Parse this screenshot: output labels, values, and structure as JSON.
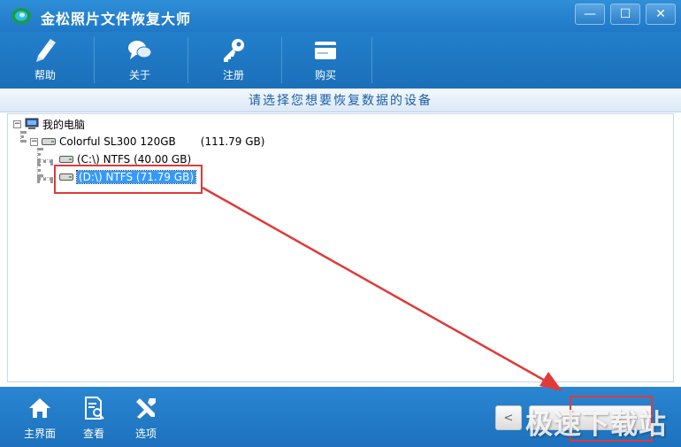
{
  "window": {
    "title": "金松照片文件恢复大师",
    "controls": {
      "minimize": "—",
      "maximize": "☐",
      "close": "✕"
    }
  },
  "toolbar": {
    "items": [
      {
        "label": "帮助",
        "icon": "help-pen-icon"
      },
      {
        "label": "关于",
        "icon": "chat-bubbles-icon"
      },
      {
        "label": "注册",
        "icon": "key-icon"
      },
      {
        "label": "购买",
        "icon": "card-icon"
      }
    ]
  },
  "header": {
    "title": "请选择您想要恢复数据的设备"
  },
  "tree": {
    "root": {
      "label": "我的电脑",
      "expander": "−"
    },
    "disk": {
      "label": "Colorful SL300 120GB",
      "size": "(111.79 GB)",
      "expander": "−"
    },
    "partitions": [
      {
        "label": "(C:\\) NTFS (40.00 GB)",
        "selected": false
      },
      {
        "label": "(D:\\) NTFS (71.79 GB)",
        "selected": true
      }
    ]
  },
  "bottombar": {
    "items": [
      {
        "label": "主界面",
        "icon": "home-icon"
      },
      {
        "label": "查看",
        "icon": "document-search-icon"
      },
      {
        "label": "选项",
        "icon": "tools-icon"
      }
    ],
    "prev_label": "<",
    "watermark": "极速下载站"
  },
  "colors": {
    "accent": "#1f78c6",
    "selection": "#3399ff",
    "annotation": "#e03a3a"
  }
}
